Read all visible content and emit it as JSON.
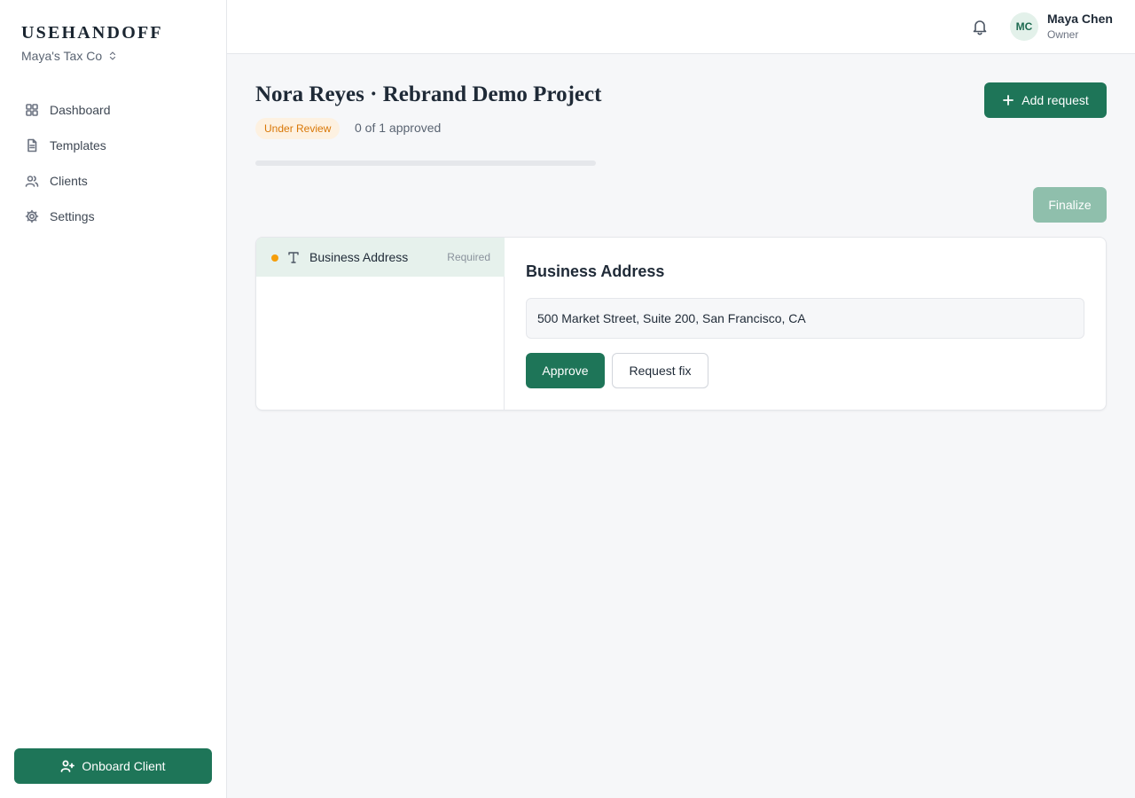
{
  "sidebar": {
    "brand": "USEHANDOFF",
    "org_name": "Maya's Tax Co",
    "nav": [
      {
        "label": "Dashboard",
        "icon": "grid-icon"
      },
      {
        "label": "Templates",
        "icon": "document-icon"
      },
      {
        "label": "Clients",
        "icon": "users-icon"
      },
      {
        "label": "Settings",
        "icon": "gear-icon"
      }
    ],
    "onboard_label": "Onboard Client"
  },
  "topbar": {
    "notifications_icon": "bell-icon",
    "user": {
      "initials": "MC",
      "name": "Maya Chen",
      "role": "Owner"
    }
  },
  "project": {
    "title": "Nora Reyes · Rebrand Demo Project",
    "status": "Under Review",
    "approved_text": "0 of 1 approved",
    "progress": 0,
    "add_request_label": "Add request",
    "finalize_label": "Finalize"
  },
  "requests": [
    {
      "label": "Business Address",
      "type_icon": "text-type-icon",
      "requirement": "Required",
      "status_color": "#f59e0b"
    }
  ],
  "detail": {
    "title": "Business Address",
    "value": "500 Market Street, Suite 200, San Francisco, CA",
    "approve_label": "Approve",
    "request_fix_label": "Request fix"
  },
  "colors": {
    "accent": "#1e7558",
    "status_pending": "#f59e0b",
    "badge_bg": "#fdf1e1",
    "badge_text": "#d97706"
  }
}
